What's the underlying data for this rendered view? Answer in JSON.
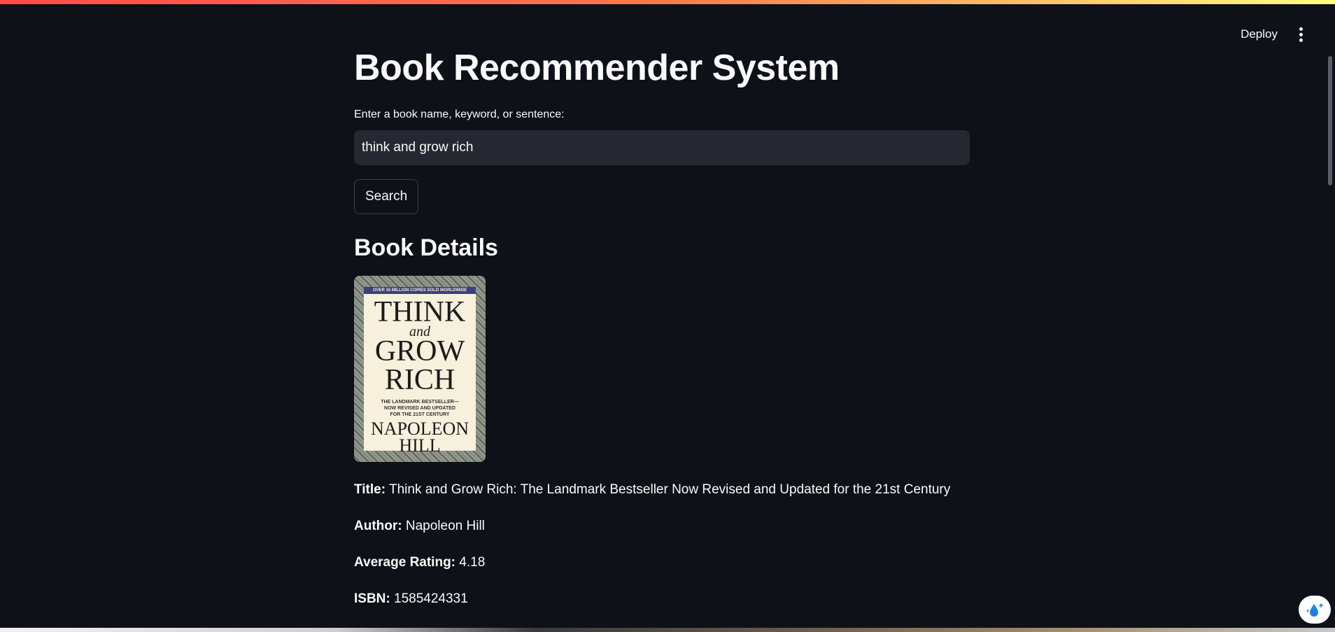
{
  "header": {
    "deploy_label": "Deploy",
    "menu_icon": "kebab-menu-icon"
  },
  "main": {
    "title": "Book Recommender System",
    "search": {
      "label": "Enter a book name, keyword, or sentence:",
      "value": "think and grow rich",
      "button_label": "Search"
    },
    "details_heading": "Book Details",
    "book": {
      "cover_text": {
        "top_banner": "OVER 15 MILLION COPIES SOLD WORLDWIDE",
        "line1": "THINK",
        "line2": "and",
        "line3": "GROW",
        "line4": "RICH",
        "subtitle1": "THE LANDMARK BESTSELLER—",
        "subtitle2": "NOW REVISED AND UPDATED",
        "subtitle3": "FOR THE 21ST CENTURY",
        "author1": "NAPOLEON",
        "author2": "HILL"
      },
      "title_label": "Title:",
      "title": "Think and Grow Rich: The Landmark Bestseller Now Revised and Updated for the 21st Century",
      "author_label": "Author:",
      "author": "Napoleon Hill",
      "rating_label": "Average Rating:",
      "rating": "4.18",
      "isbn_label": "ISBN:",
      "isbn": "1585424331"
    }
  },
  "colors": {
    "background": "#0e1117",
    "input_bg": "#262730",
    "text": "#fafafa",
    "accent": "#ff4b4b"
  }
}
